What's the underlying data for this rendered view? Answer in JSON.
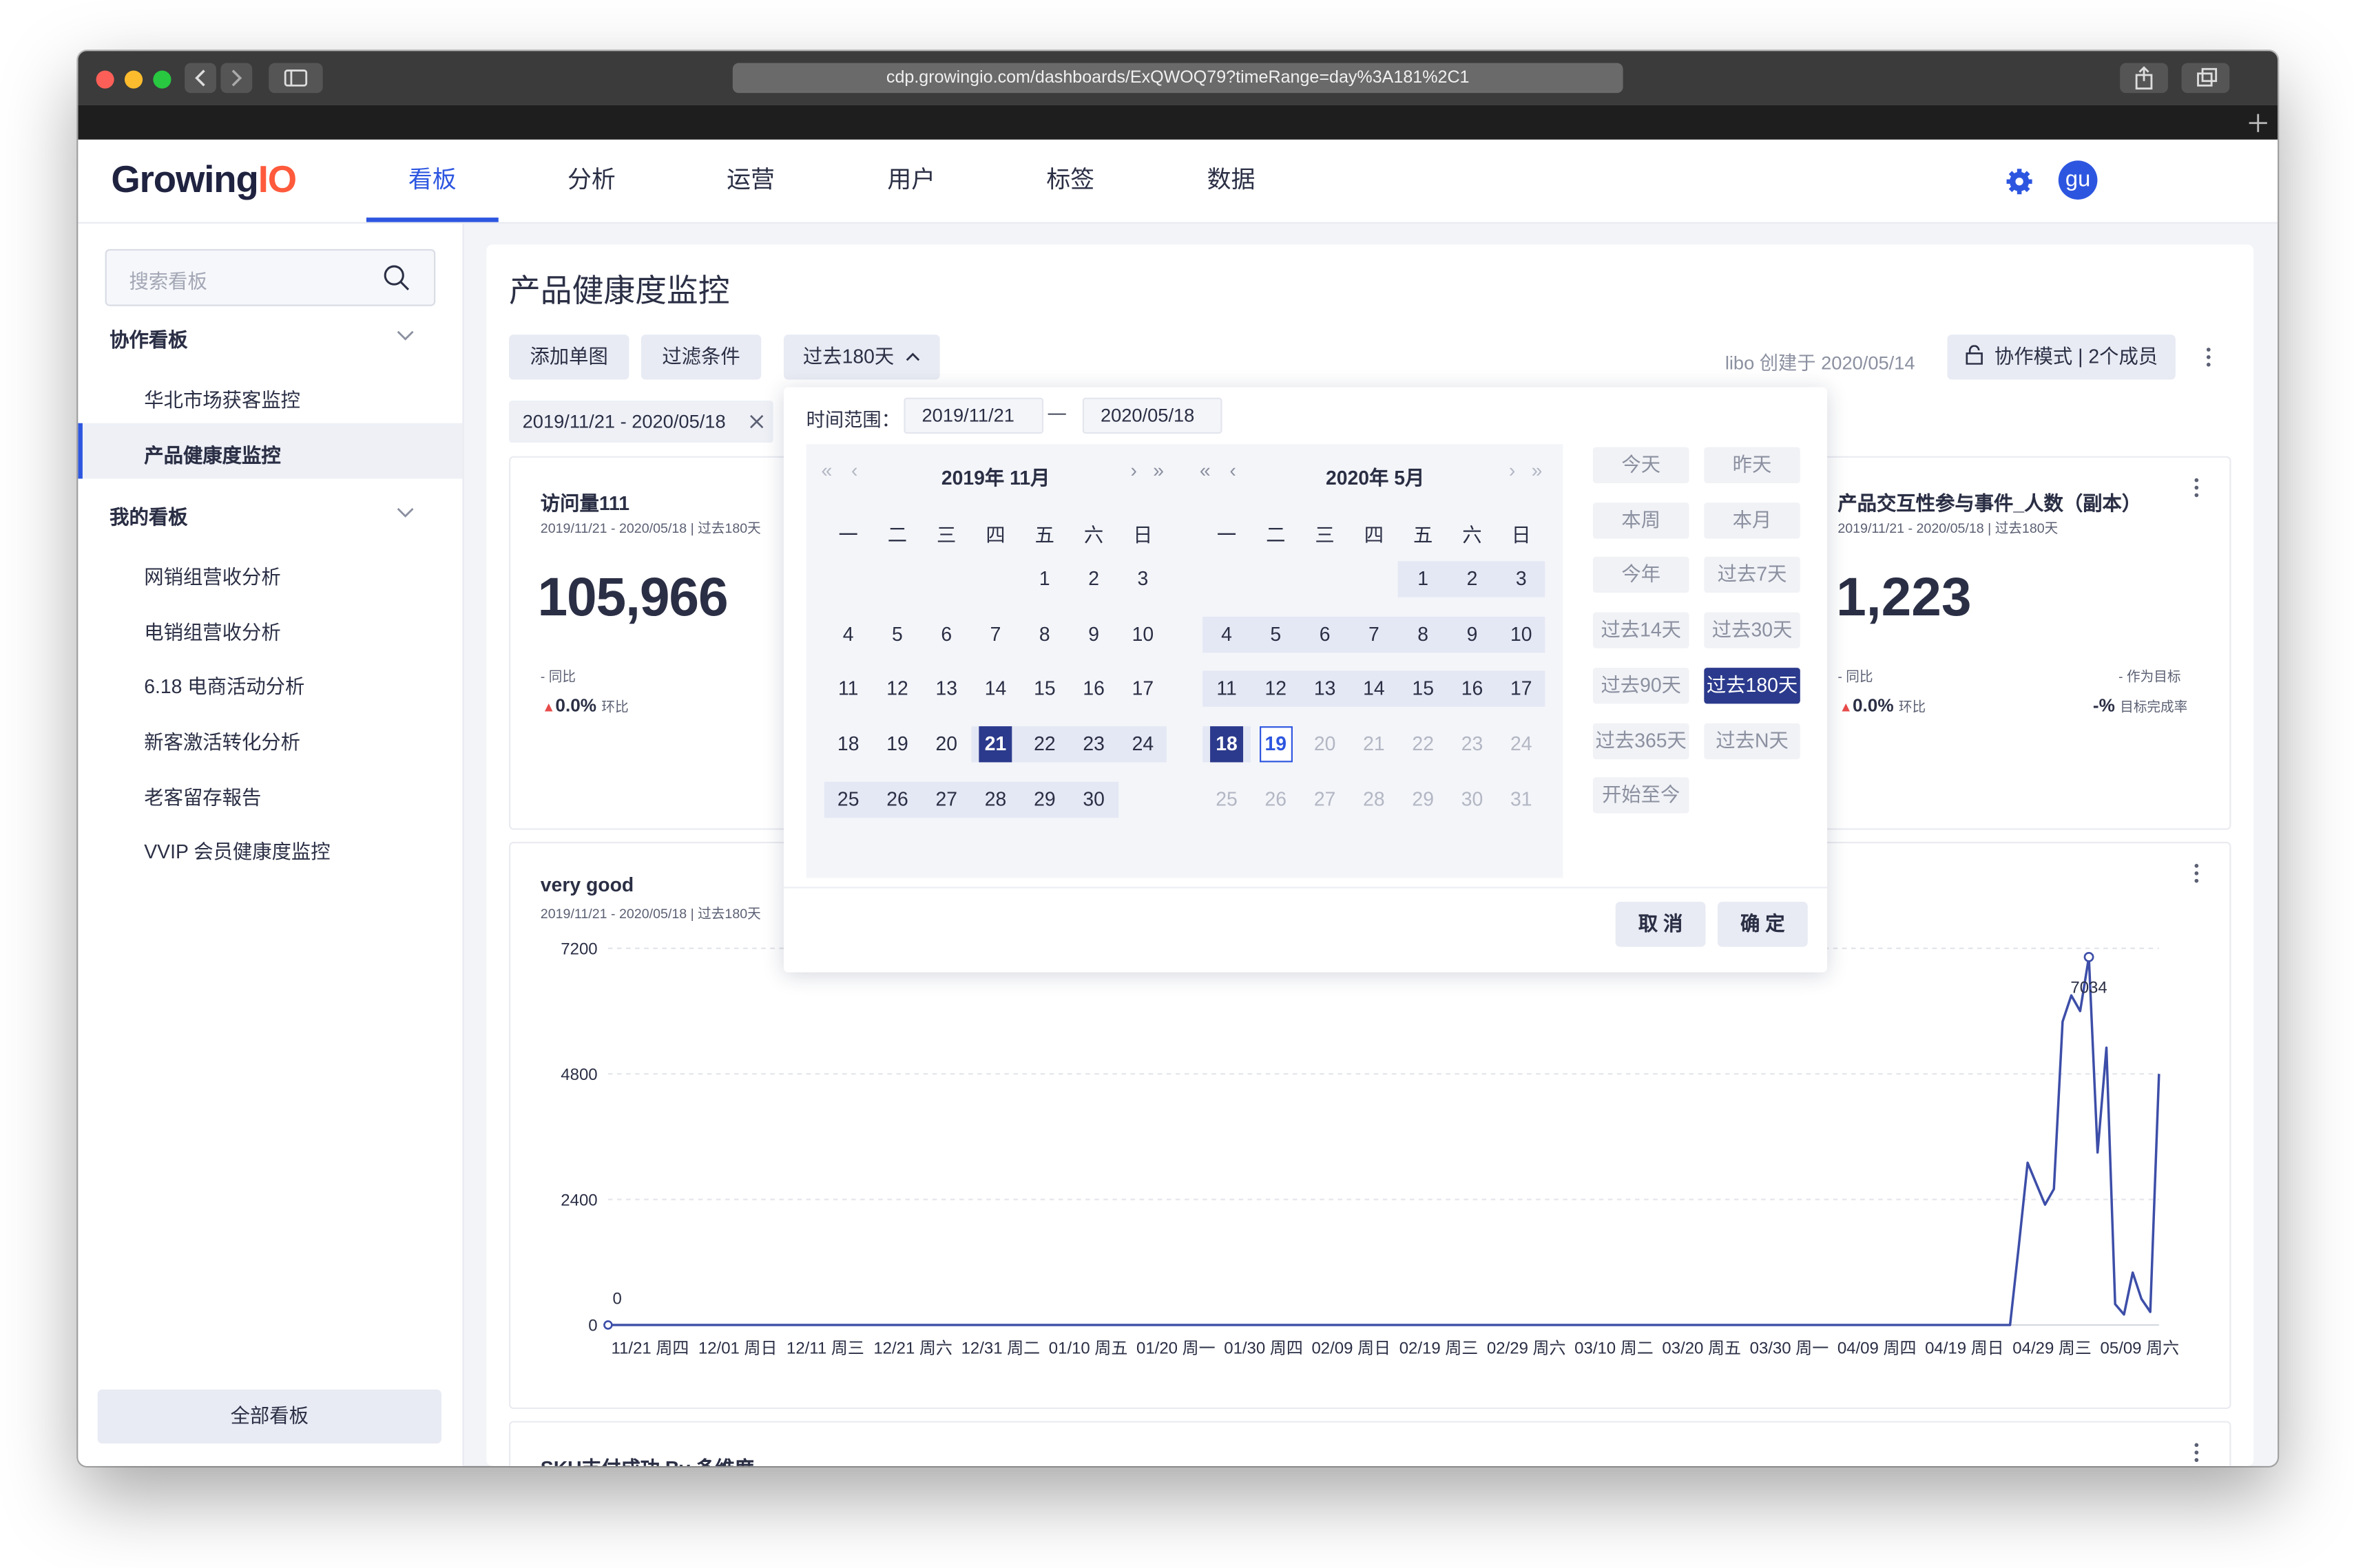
{
  "browser": {
    "url": "cdp.growingio.com/dashboards/ExQWOQ79?timeRange=day%3A181%2C1"
  },
  "app": {
    "logo": "GrowingIO",
    "nav": [
      "看板",
      "分析",
      "运营",
      "用户",
      "标签",
      "数据"
    ],
    "active_nav": "看板",
    "avatar": "gu"
  },
  "sidebar": {
    "search_placeholder": "搜索看板",
    "group1": "协作看板",
    "group1_items": [
      "华北市场获客监控",
      "产品健康度监控"
    ],
    "group2": "我的看板",
    "group2_items": [
      "网销组营收分析",
      "电销组营收分析",
      "6.18 电商活动分析",
      "新客激活转化分析",
      "老客留存報告",
      "VVIP 会员健康度监控"
    ],
    "all_boards": "全部看板"
  },
  "main": {
    "title": "产品健康度监控",
    "add_chart": "添加单图",
    "filter": "过滤条件",
    "range_button": "过去180天",
    "creator": "libo 创建于 2020/05/14",
    "collab": "协作模式 | 2个成员",
    "date_chip": "2019/11/21 - 2020/05/18"
  },
  "cards": {
    "visits": {
      "title": "访问量111",
      "subtitle": "2019/11/21 - 2020/05/18 | 过去180天",
      "value": "105,966",
      "yoy": "- 同比",
      "mom_value": "0.0%",
      "mom_label": "环比"
    },
    "interaction": {
      "title": "产品交互性参与事件_人数（副本）",
      "subtitle": "2019/11/21 - 2020/05/18 | 过去180天",
      "value": "1,223",
      "yoy": "- 同比",
      "mom_value": "0.0%",
      "mom_label": "环比",
      "target": "- 作为目标",
      "completion": "-%",
      "completion_label": "目标完成率"
    },
    "line": {
      "title": "very good",
      "subtitle": "2019/11/21 - 2020/05/18 | 过去180天",
      "start_label": "0",
      "peak_label": "7034"
    },
    "sku": {
      "title": "SKU支付成功 By 多维度"
    }
  },
  "picker": {
    "range_label": "时间范围：",
    "start": "2019/11/21",
    "dash": "—",
    "end": "2020/05/18",
    "left_month": "2019年 11月",
    "right_month": "2020年 5月",
    "weekdays": [
      "一",
      "二",
      "三",
      "四",
      "五",
      "六",
      "日"
    ],
    "quick": [
      "今天",
      "昨天",
      "本周",
      "本月",
      "今年",
      "过去7天",
      "过去14天",
      "过去30天",
      "过去90天",
      "过去180天",
      "过去365天",
      "过去N天",
      "开始至今"
    ],
    "selected_quick": "过去180天",
    "cancel": "取 消",
    "ok": "确 定"
  },
  "chart_data": {
    "type": "line",
    "title": "very good",
    "x": [
      "11/21 周四",
      "12/01 周日",
      "12/11 周三",
      "12/21 周六",
      "12/31 周二",
      "01/10 周五",
      "01/20 周一",
      "01/30 周四",
      "02/09 周日",
      "02/19 周三",
      "02/29 周六",
      "03/10 周二",
      "03/20 周五",
      "03/30 周一",
      "04/09 周四",
      "04/19 周日",
      "04/29 周三",
      "05/09 周六"
    ],
    "yticks": [
      0,
      2400,
      4800,
      7200
    ],
    "ylim": [
      0,
      7200
    ],
    "series": [
      {
        "values_by_day_offset": [
          [
            0,
            0
          ],
          [
            160,
            0
          ],
          [
            161,
            1500
          ],
          [
            162,
            3100
          ],
          [
            163,
            2700
          ],
          [
            164,
            2300
          ],
          [
            165,
            2600
          ],
          [
            166,
            5800
          ],
          [
            167,
            6300
          ],
          [
            168,
            6000
          ],
          [
            169,
            7034
          ],
          [
            170,
            3300
          ],
          [
            171,
            5300
          ],
          [
            172,
            400
          ],
          [
            173,
            200
          ],
          [
            174,
            1000
          ],
          [
            175,
            500
          ],
          [
            176,
            250
          ],
          [
            177,
            4800
          ]
        ],
        "peak_label": 7034
      }
    ],
    "grid": true
  }
}
